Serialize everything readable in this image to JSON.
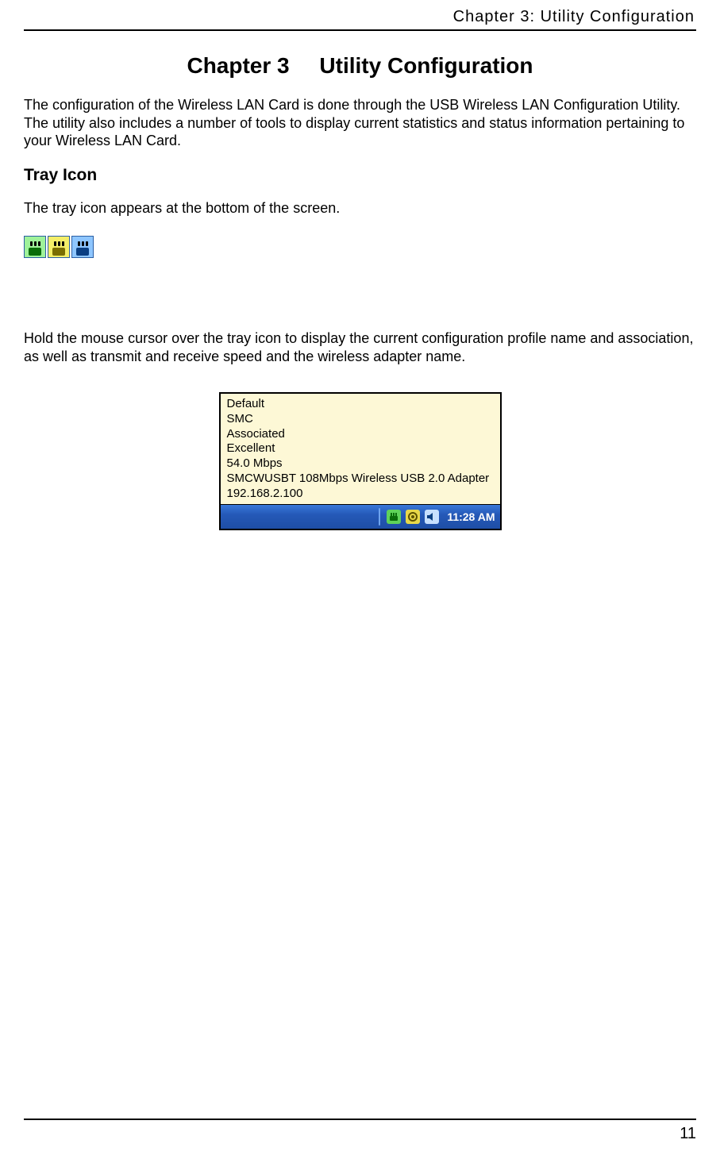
{
  "running_head": "Chapter 3: Utility Configuration",
  "title": {
    "chapter": "Chapter 3",
    "text": "Utility Configuration"
  },
  "intro": "The configuration of the Wireless LAN Card is done through the USB Wireless LAN Configuration Utility. The utility also includes a number of tools to display current statistics and status information pertaining to your Wireless LAN Card.",
  "tray_section_title": "Tray Icon",
  "tray_para": "The tray icon appears at the bottom of the screen.",
  "tooltip_intro": "Hold the mouse cursor over the tray icon to display the current configuration profile name and association, as well as transmit and receive speed and the wireless adapter name.",
  "tooltip_lines": [
    "Default",
    "SMC",
    "Associated",
    "Excellent",
    "54.0 Mbps",
    "SMCWUSBT 108Mbps Wireless USB 2.0 Adapter",
    "192.168.2.100"
  ],
  "taskbar": {
    "clock": "11:28 AM"
  },
  "page_number": "11"
}
